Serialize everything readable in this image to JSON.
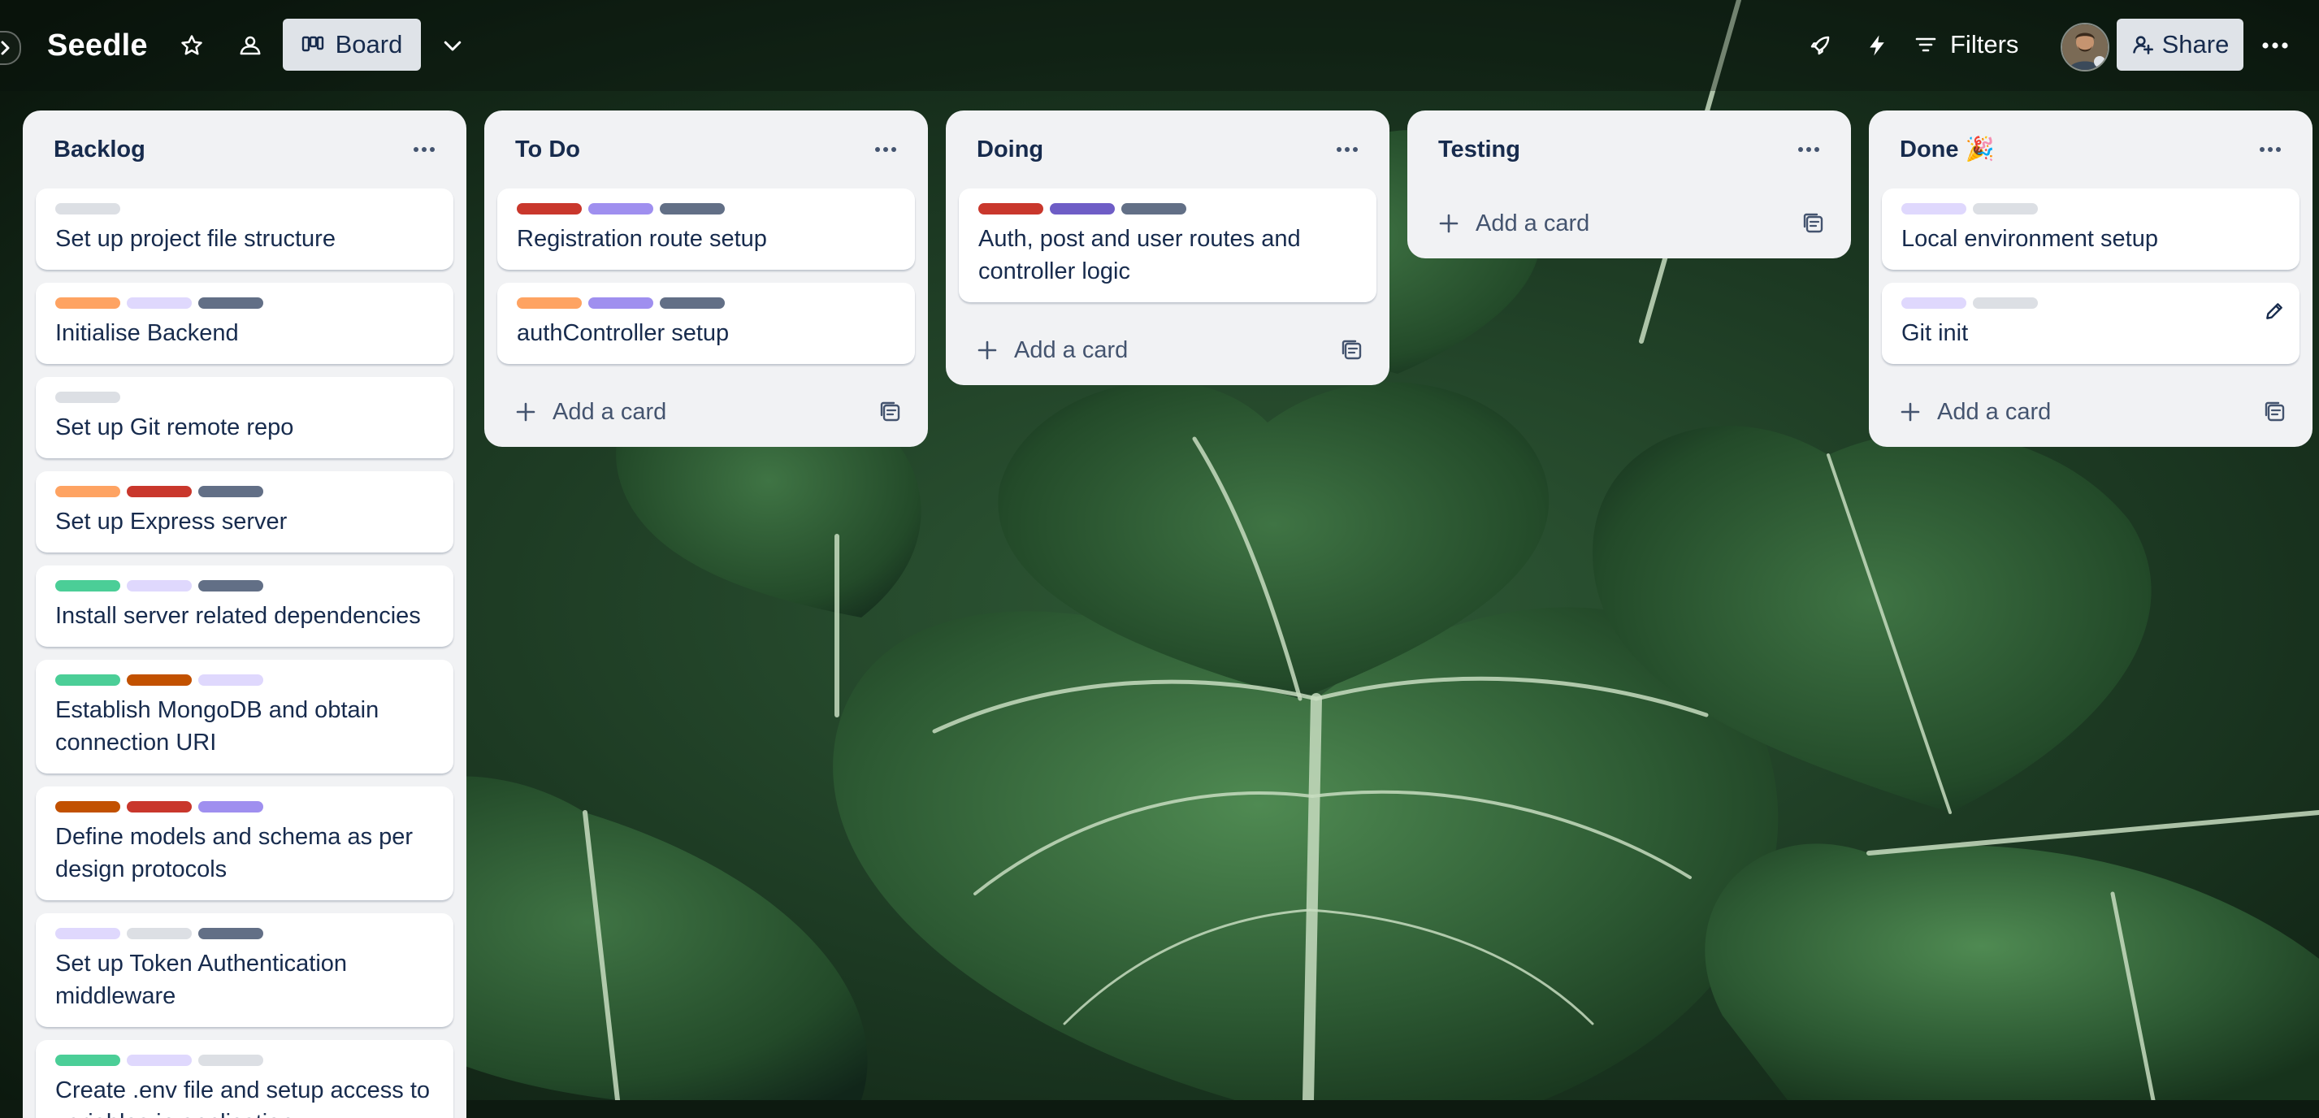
{
  "board": {
    "title": "Seedle",
    "view_label": "Board"
  },
  "header": {
    "filters_label": "Filters",
    "share_label": "Share"
  },
  "icons": {
    "sidebar_toggle": "chevron-right-icon",
    "star": "star-icon",
    "visibility": "team-visibility-icon",
    "view": "board-view-icon",
    "view_dropdown": "chevron-down-icon",
    "power_ups": "rocket-icon",
    "automation": "lightning-icon",
    "filters": "filter-icon",
    "share": "add-person-icon",
    "more": "more-horizontal-icon",
    "list_menu": "more-horizontal-icon",
    "add_card": "plus-icon",
    "template": "card-template-icon",
    "edit": "pencil-icon"
  },
  "label_colors": {
    "gray": "#dcdfe4",
    "orange": "#fea362",
    "lavender": "#dfd8fd",
    "slate": "#626f86",
    "red": "#c9372c",
    "purple": "#9f8fef",
    "green": "#4bce97",
    "rust": "#c25100",
    "violet": "#6e5dc6"
  },
  "lists": [
    {
      "title": "Backlog",
      "cards": [
        {
          "labels": [
            "gray"
          ],
          "title": "Set up project file structure"
        },
        {
          "labels": [
            "orange",
            "lavender",
            "slate"
          ],
          "title": "Initialise Backend"
        },
        {
          "labels": [
            "gray"
          ],
          "title": "Set up Git remote repo"
        },
        {
          "labels": [
            "orange",
            "red",
            "slate"
          ],
          "title": "Set up Express server"
        },
        {
          "labels": [
            "green",
            "lavender",
            "slate"
          ],
          "title": "Install server related dependencies"
        },
        {
          "labels": [
            "green",
            "rust",
            "lavender"
          ],
          "title": "Establish MongoDB and obtain connection URI"
        },
        {
          "labels": [
            "rust",
            "red",
            "purple"
          ],
          "title": "Define models and schema as per design protocols"
        },
        {
          "labels": [
            "lavender",
            "gray",
            "slate"
          ],
          "title": "Set up Token Authentication middleware"
        },
        {
          "labels": [
            "green",
            "lavender",
            "gray"
          ],
          "title": "Create .env file and setup access to variables in application"
        }
      ],
      "add_card_label": ""
    },
    {
      "title": "To Do",
      "cards": [
        {
          "labels": [
            "red",
            "purple",
            "slate"
          ],
          "title": "Registration route setup"
        },
        {
          "labels": [
            "orange",
            "purple",
            "slate"
          ],
          "title": "authController setup"
        }
      ],
      "add_card_label": "Add a card"
    },
    {
      "title": "Doing",
      "cards": [
        {
          "labels": [
            "red",
            "violet",
            "slate"
          ],
          "title": "Auth, post and user routes and controller logic"
        }
      ],
      "add_card_label": "Add a card"
    },
    {
      "title": "Testing",
      "cards": [],
      "add_card_label": "Add a card"
    },
    {
      "title": "Done 🎉",
      "cards": [
        {
          "labels": [
            "lavender",
            "gray"
          ],
          "title": "Local environment setup"
        },
        {
          "labels": [
            "lavender",
            "gray"
          ],
          "title": "Git init"
        }
      ],
      "add_card_label": "Add a card"
    }
  ]
}
